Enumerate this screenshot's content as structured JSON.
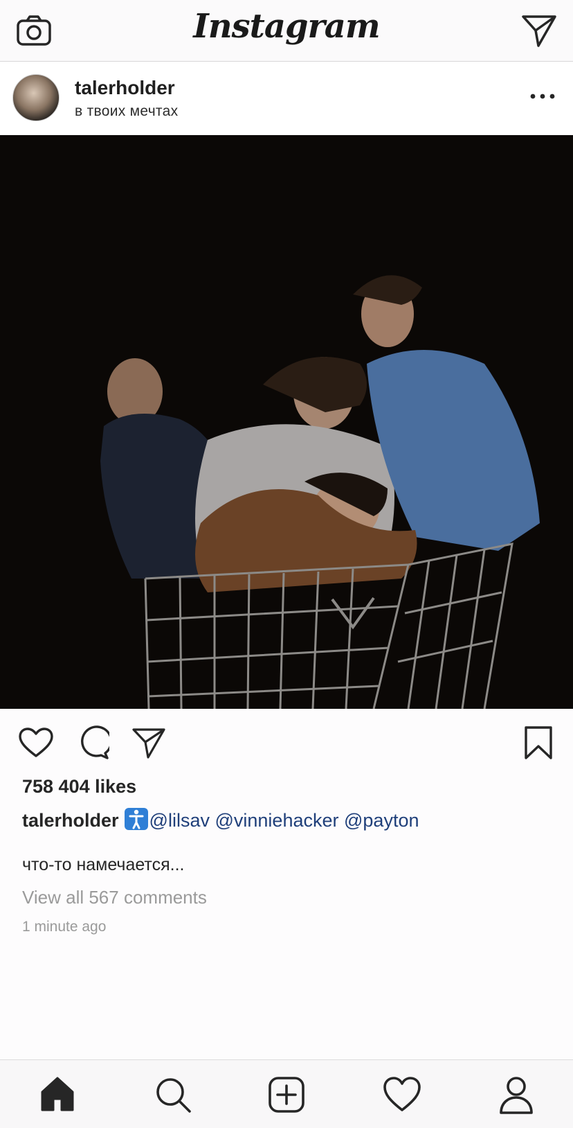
{
  "topbar": {
    "logo": "Instagram",
    "camera_icon": "camera-icon",
    "direct_icon": "direct-message-icon"
  },
  "post": {
    "username": "talerholder",
    "location": "в твоих мечтах",
    "more_icon": "more-options-icon",
    "likes": "758 404 likes",
    "caption_user": "talerholder",
    "caption_emoji": "person-standing-emoji",
    "caption_tags": [
      "@lilsav",
      "@vinniehacker",
      "@payton"
    ],
    "caption_text": "что-то намечается...",
    "view_comments": "View all 567 comments",
    "time_ago": "1 minute ago"
  },
  "actions": {
    "like_icon": "heart-icon",
    "comment_icon": "comment-icon",
    "share_icon": "share-icon",
    "save_icon": "bookmark-icon"
  },
  "bottomnav": {
    "items": [
      "home-icon",
      "search-icon",
      "new-post-icon",
      "activity-heart-icon",
      "profile-icon"
    ]
  },
  "colors": {
    "text": "#262626",
    "muted": "#9a9a9a",
    "tag_blue": "#1f3f7a",
    "photo_bg": "#0b0806"
  }
}
